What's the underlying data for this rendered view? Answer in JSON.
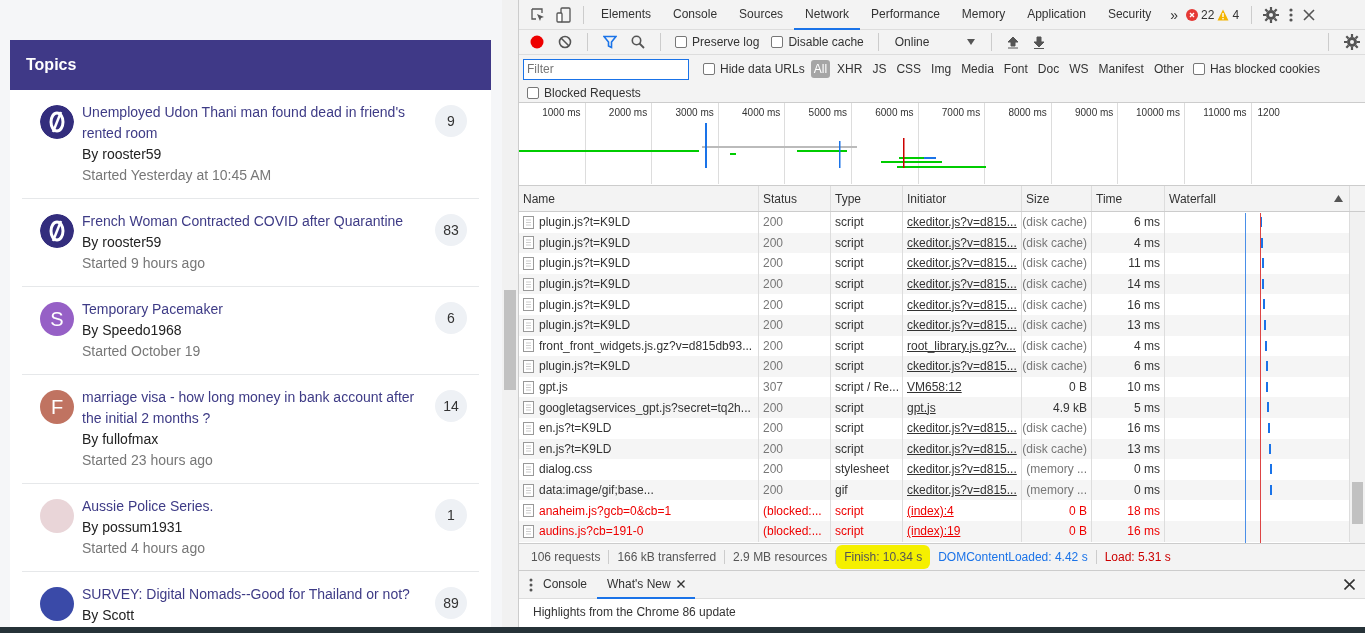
{
  "topics": {
    "title": "Topics",
    "items": [
      {
        "title": "Unemployed Udon Thani man found dead in friend's rented room",
        "author": "By rooster59",
        "started": "Started Yesterday at 10:45 AM",
        "replies": "9",
        "avatar": {
          "kind": "logo"
        }
      },
      {
        "title": "French Woman Contracted COVID after Quarantine",
        "author": "By rooster59",
        "started": "Started 9 hours ago",
        "replies": "83",
        "avatar": {
          "kind": "logo"
        }
      },
      {
        "title": "Temporary Pacemaker",
        "author": "By Speedo1968",
        "started": "Started October 19",
        "replies": "6",
        "avatar": {
          "kind": "letter",
          "letter": "S",
          "color": "#9660c6"
        }
      },
      {
        "title": "marriage visa - how long money in bank account after the initial 2 months ?",
        "author": "By fullofmax",
        "started": "Started 23 hours ago",
        "replies": "14",
        "avatar": {
          "kind": "letter",
          "letter": "F",
          "color": "#c07361"
        }
      },
      {
        "title": "Aussie Police Series.",
        "author": "By possum1931",
        "started": "Started 4 hours ago",
        "replies": "1",
        "avatar": {
          "kind": "photo"
        }
      },
      {
        "title": "SURVEY: Digital Nomads--Good for Thailand or not?",
        "author": "By Scott",
        "replies": "89",
        "avatar": {
          "kind": "photo"
        }
      }
    ]
  },
  "devtools": {
    "tabs": [
      {
        "label": "Elements",
        "selected": false
      },
      {
        "label": "Console",
        "selected": false
      },
      {
        "label": "Sources",
        "selected": false
      },
      {
        "label": "Network",
        "selected": true
      },
      {
        "label": "Performance",
        "selected": false
      },
      {
        "label": "Memory",
        "selected": false
      },
      {
        "label": "Application",
        "selected": false
      },
      {
        "label": "Security",
        "selected": false
      }
    ],
    "more_tabs": "»",
    "errors": "22",
    "warnings": "4",
    "network_toolbar": {
      "checkboxes": [
        {
          "label": "Preserve log",
          "checked": false
        },
        {
          "label": "Disable cache",
          "checked": false
        }
      ],
      "throttling": "Online"
    },
    "filter_bar": {
      "filter": {
        "placeholder": "Filter"
      },
      "hide_data_urls": {
        "label": "Hide data URLs",
        "checked": false
      },
      "types": [
        {
          "label": "All",
          "selected": true
        },
        {
          "label": "XHR",
          "selected": false
        },
        {
          "label": "JS",
          "selected": false
        },
        {
          "label": "CSS",
          "selected": false
        },
        {
          "label": "Img",
          "selected": false
        },
        {
          "label": "Media",
          "selected": false
        },
        {
          "label": "Font",
          "selected": false
        },
        {
          "label": "Doc",
          "selected": false
        },
        {
          "label": "WS",
          "selected": false
        },
        {
          "label": "Manifest",
          "selected": false
        },
        {
          "label": "Other",
          "selected": false
        }
      ],
      "has_blocked_cookies": {
        "label": "Has blocked cookies",
        "checked": false
      },
      "blocked_requests": {
        "label": "Blocked Requests",
        "checked": false
      }
    },
    "overview": {
      "ticks": [
        "1000 ms",
        "2000 ms",
        "3000 ms",
        "4000 ms",
        "5000 ms",
        "6000 ms",
        "7000 ms",
        "8000 ms",
        "9000 ms",
        "10000 ms",
        "11000 ms",
        "1200"
      ]
    },
    "table": {
      "columns": [
        "Name",
        "Status",
        "Type",
        "Initiator",
        "Size",
        "Time",
        "Waterfall"
      ],
      "rows": [
        {
          "name": "plugin.js?t=K9LD",
          "status": "200",
          "type": "script",
          "initiator": "ckeditor.js?v=d815...",
          "size": "(disk cache)",
          "time": "6 ms",
          "blocked": false
        },
        {
          "name": "plugin.js?t=K9LD",
          "status": "200",
          "type": "script",
          "initiator": "ckeditor.js?v=d815...",
          "size": "(disk cache)",
          "time": "4 ms",
          "blocked": false
        },
        {
          "name": "plugin.js?t=K9LD",
          "status": "200",
          "type": "script",
          "initiator": "ckeditor.js?v=d815...",
          "size": "(disk cache)",
          "time": "11 ms",
          "blocked": false
        },
        {
          "name": "plugin.js?t=K9LD",
          "status": "200",
          "type": "script",
          "initiator": "ckeditor.js?v=d815...",
          "size": "(disk cache)",
          "time": "14 ms",
          "blocked": false
        },
        {
          "name": "plugin.js?t=K9LD",
          "status": "200",
          "type": "script",
          "initiator": "ckeditor.js?v=d815...",
          "size": "(disk cache)",
          "time": "16 ms",
          "blocked": false
        },
        {
          "name": "plugin.js?t=K9LD",
          "status": "200",
          "type": "script",
          "initiator": "ckeditor.js?v=d815...",
          "size": "(disk cache)",
          "time": "13 ms",
          "blocked": false
        },
        {
          "name": "front_front_widgets.js.gz?v=d815db93...",
          "status": "200",
          "type": "script",
          "initiator": "root_library.js.gz?v...",
          "size": "(disk cache)",
          "time": "4 ms",
          "blocked": false
        },
        {
          "name": "plugin.js?t=K9LD",
          "status": "200",
          "type": "script",
          "initiator": "ckeditor.js?v=d815...",
          "size": "(disk cache)",
          "time": "6 ms",
          "blocked": false
        },
        {
          "name": "gpt.js",
          "status": "307",
          "type": "script / Re...",
          "initiator": "VM658:12",
          "size": "0 B",
          "time": "10 ms",
          "blocked": false
        },
        {
          "name": "googletagservices_gpt.js?secret=tq2h...",
          "status": "200",
          "type": "script",
          "initiator": "gpt.js",
          "size": "4.9 kB",
          "time": "5 ms",
          "blocked": false
        },
        {
          "name": "en.js?t=K9LD",
          "status": "200",
          "type": "script",
          "initiator": "ckeditor.js?v=d815...",
          "size": "(disk cache)",
          "time": "16 ms",
          "blocked": false
        },
        {
          "name": "en.js?t=K9LD",
          "status": "200",
          "type": "script",
          "initiator": "ckeditor.js?v=d815...",
          "size": "(disk cache)",
          "time": "13 ms",
          "blocked": false
        },
        {
          "name": "dialog.css",
          "status": "200",
          "type": "stylesheet",
          "initiator": "ckeditor.js?v=d815...",
          "size": "(memory ...",
          "time": "0 ms",
          "blocked": false
        },
        {
          "name": "data:image/gif;base...",
          "status": "200",
          "type": "gif",
          "initiator": "ckeditor.js?v=d815...",
          "size": "(memory ...",
          "time": "0 ms",
          "blocked": false
        },
        {
          "name": "anaheim.js?gcb=0&cb=1",
          "status": "(blocked:...",
          "type": "script",
          "initiator": "(index):4",
          "size": "0 B",
          "time": "18 ms",
          "blocked": true
        },
        {
          "name": "audins.js?cb=191-0",
          "status": "(blocked:...",
          "type": "script",
          "initiator": "(index):19",
          "size": "0 B",
          "time": "16 ms",
          "blocked": true
        }
      ]
    },
    "status_bar": [
      {
        "text": "106 requests",
        "kind": "plain",
        "highlighted": false
      },
      {
        "text": "166 kB transferred",
        "kind": "plain",
        "highlighted": false
      },
      {
        "text": "2.9 MB resources",
        "kind": "plain",
        "highlighted": false
      },
      {
        "text": "Finish: 10.34 s",
        "kind": "plain",
        "highlighted": true
      },
      {
        "text": "DOMContentLoaded: 4.42 s",
        "kind": "dom",
        "highlighted": false
      },
      {
        "text": "Load: 5.31 s",
        "kind": "load",
        "highlighted": false
      }
    ],
    "drawer": {
      "tabs": [
        {
          "label": "Console",
          "selected": false,
          "closable": false
        },
        {
          "label": "What's New",
          "selected": true,
          "closable": true
        }
      ],
      "content": "Highlights from the Chrome 86 update"
    }
  }
}
